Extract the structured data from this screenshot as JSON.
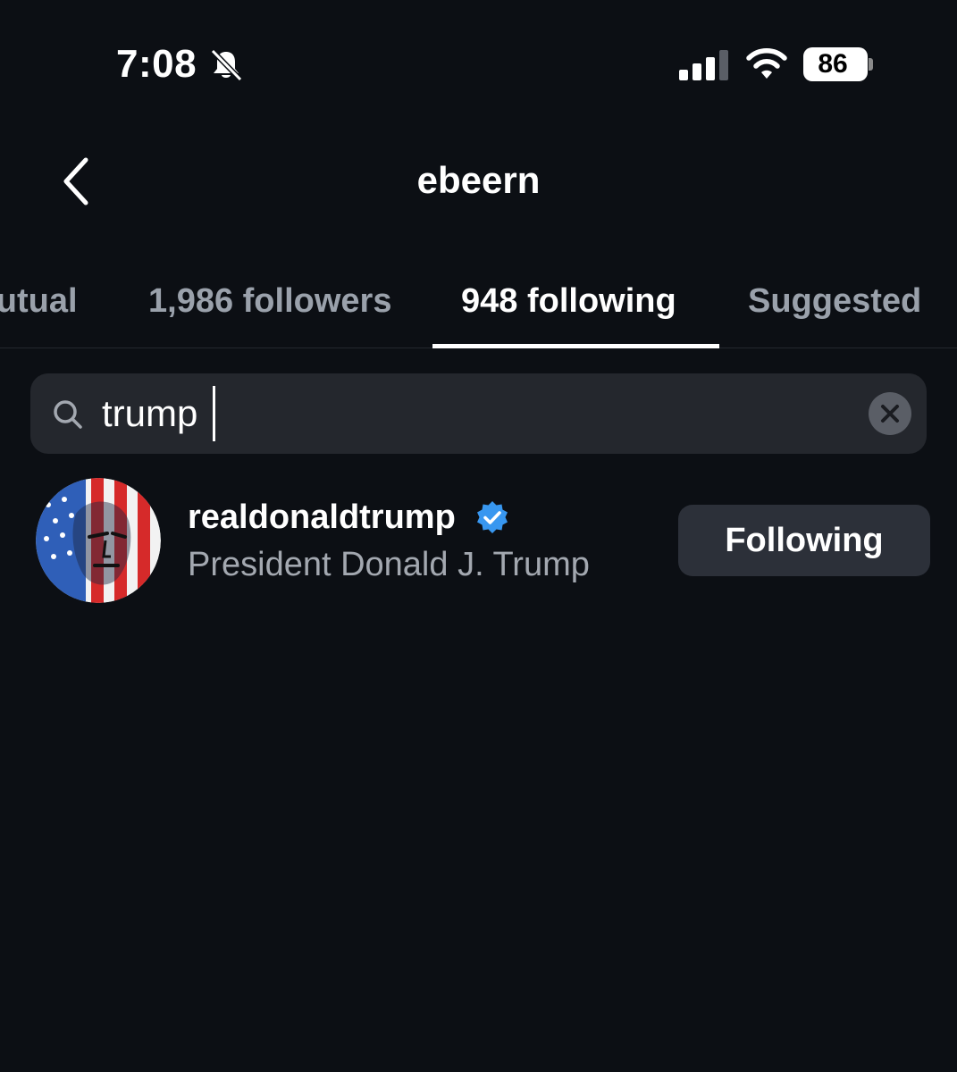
{
  "status_bar": {
    "time": "7:08",
    "battery": "86",
    "icons": [
      "bell-slash-icon",
      "cellular-signal-icon",
      "wifi-icon",
      "battery-icon"
    ]
  },
  "header": {
    "title": "ebeern",
    "back_icon": "chevron-left-icon"
  },
  "tabs": [
    {
      "label": "mutual",
      "selected": false
    },
    {
      "label": "1,986 followers",
      "selected": false
    },
    {
      "label": "948 following",
      "selected": true
    },
    {
      "label": "Suggested",
      "selected": false
    }
  ],
  "search": {
    "value": "trump",
    "icons": [
      "search-icon",
      "clear-icon"
    ]
  },
  "results": [
    {
      "username": "realdonaldtrump",
      "full_name": "President Donald J. Trump",
      "verified": true,
      "button_label": "Following"
    }
  ],
  "colors": {
    "background": "#0c0f14",
    "search_field": "#24272d",
    "button": "#2c3039",
    "verified": "#3897f0",
    "muted_text": "#9aa1ab"
  }
}
